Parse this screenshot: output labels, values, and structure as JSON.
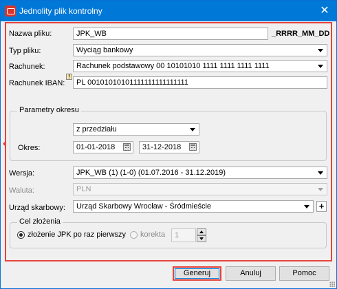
{
  "window": {
    "title": "Jednolity plik kontrolny",
    "close_label": "✕"
  },
  "form": {
    "file_name_label": "Nazwa pliku:",
    "file_name_value": "JPK_WB",
    "file_name_suffix": "_RRRR_MM_DD",
    "file_type_label": "Typ pliku:",
    "file_type_value": "Wyciąg bankowy",
    "account_label": "Rachunek:",
    "account_value": "Rachunek podstawowy 00 10101010 1111 1111 1111 1111",
    "iban_label": "Rachunek IBAN:",
    "iban_warning": "!",
    "iban_value": "PL 00101010101111111111111111",
    "period_group": {
      "title": "Parametry okresu",
      "range_value": "z przedziału",
      "period_label": "Okres:",
      "date_from": "01-01-2018",
      "date_to": "31-12-2018"
    },
    "version_label": "Wersja:",
    "version_value": "JPK_WB (1) (1-0) (01.07.2016 - 31.12.2019)",
    "currency_label": "Waluta:",
    "currency_value": "PLN",
    "tax_office_label": "Urząd skarbowy:",
    "tax_office_value": "Urząd Skarbowy Wrocław - Śródmieście",
    "tax_office_add": "+",
    "purpose_group": {
      "title": "Cel złożenia",
      "option_first": "złożenie JPK po raz pierwszy",
      "option_correction": "korekta",
      "correction_number": "1"
    }
  },
  "buttons": {
    "generate": "Generuj",
    "cancel": "Anuluj",
    "help": "Pomoc"
  },
  "colors": {
    "titlebar": "#0078d7",
    "highlight": "#e8433c"
  }
}
